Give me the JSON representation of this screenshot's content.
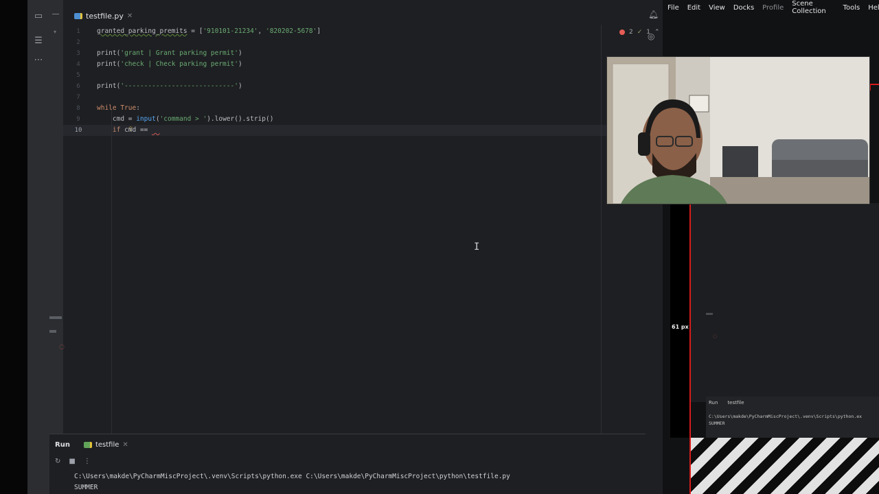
{
  "ide": {
    "tab_label": "testfile.py",
    "inspection": {
      "errors": "2",
      "warnings": "1"
    },
    "line_numbers": [
      "1",
      "2",
      "3",
      "4",
      "5",
      "6",
      "7",
      "8",
      "9",
      "10"
    ],
    "code": {
      "l1_var": "granted_parking_premits",
      "l1_rest_a": " = [",
      "l1_s1": "'910101-21234'",
      "l1_comma": ", ",
      "l1_s2": "'820202-5678'",
      "l1_end": "]",
      "l3_fn": "print",
      "l3_str": "'grant | Grant parking permit'",
      "l4_fn": "print",
      "l4_str": "'check | Check parking permit'",
      "l6_fn": "print",
      "l6_str": "'----------------------------'",
      "l8_kw": "while",
      "l8_true": " True",
      "l8_colon": ":",
      "l9_pre": "    cmd = ",
      "l9_fn": "input",
      "l9_str": "'command > '",
      "l9_post": ").lower().strip()",
      "l10_pre": "    ",
      "l10_kw": "if",
      "l10_rest": " cmd == "
    }
  },
  "run": {
    "title": "Run",
    "tab_label": "testfile",
    "output": [
      "C:\\Users\\makde\\PyCharmMiscProject\\.venv\\Scripts\\python.exe C:\\Users\\makde\\PyCharmMiscProject\\python\\testfile.py",
      "SUMMER"
    ]
  },
  "obs": {
    "menu": [
      "File",
      "Edit",
      "View",
      "Docks",
      "Profile",
      "Scene Collection",
      "Tools",
      "Help"
    ],
    "px_label": "61 px",
    "mini_run": {
      "title": "Run",
      "tab": "testfile",
      "output": [
        "C:\\Users\\makde\\PyCharmMiscProject\\.venv\\Scripts\\python.ex",
        "SUMMER"
      ]
    }
  },
  "colors": {
    "accent": "#3574f0",
    "keyword": "#cf8e6d",
    "string": "#6aab73",
    "function": "#56a8f5",
    "obs_red": "#d81b1b"
  }
}
